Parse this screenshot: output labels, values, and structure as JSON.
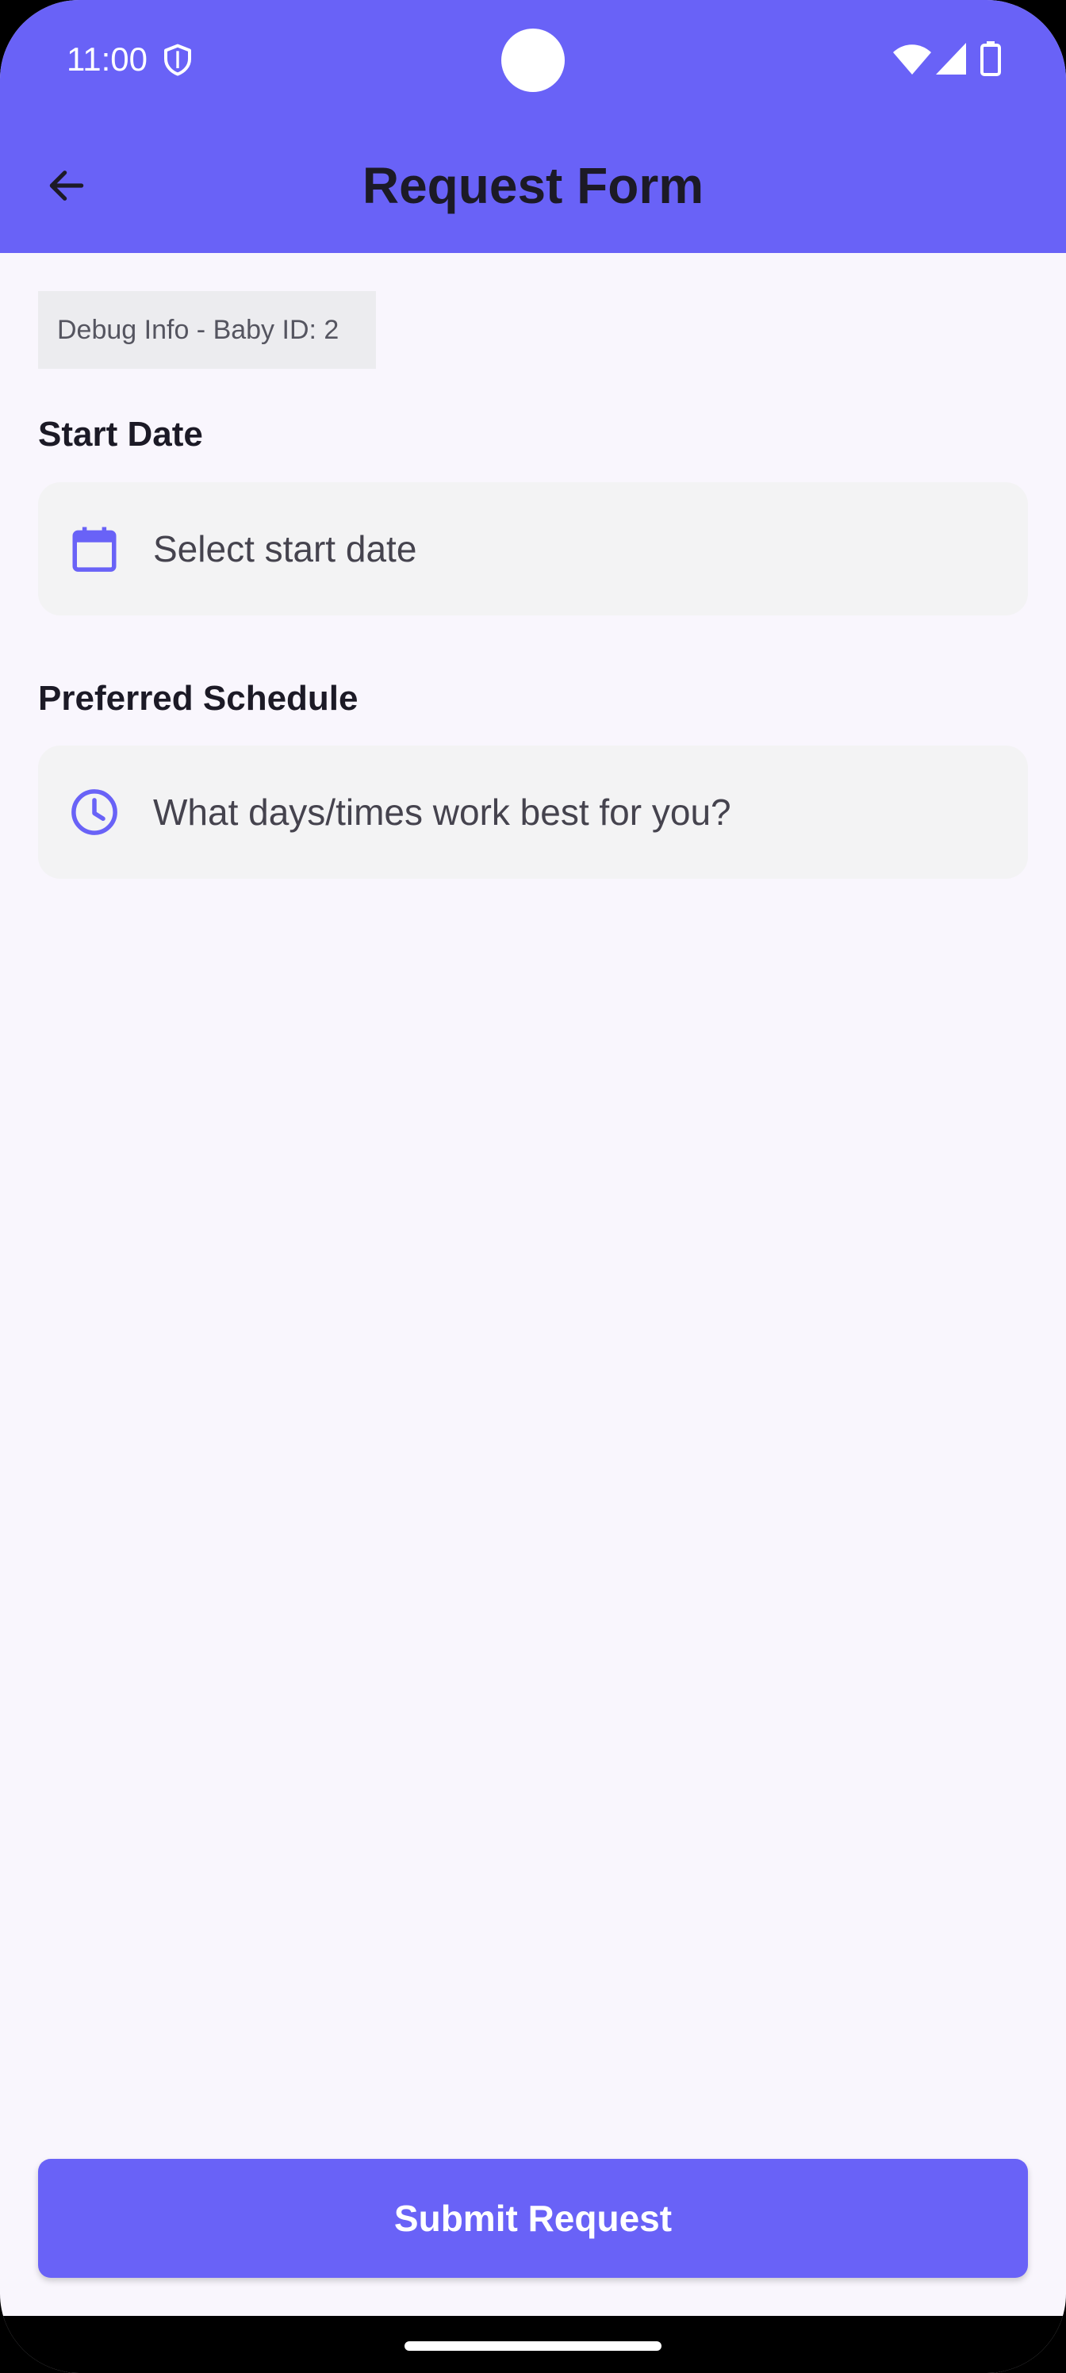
{
  "status_bar": {
    "time": "11:00",
    "icons": [
      "shield-icon",
      "wifi-icon",
      "signal-icon",
      "battery-icon"
    ]
  },
  "app_bar": {
    "title": "Request Form",
    "back_icon": "arrow-back-icon",
    "background": "#6962f7"
  },
  "debug": {
    "text": "Debug Info - Baby ID: 2"
  },
  "form": {
    "start_date": {
      "label": "Start Date",
      "placeholder": "Select start date",
      "icon": "calendar-icon"
    },
    "schedule": {
      "label": "Preferred Schedule",
      "placeholder": "What days/times work best for you?",
      "icon": "clock-icon"
    }
  },
  "actions": {
    "submit_label": "Submit Request"
  },
  "colors": {
    "accent": "#6962f7",
    "field_bg": "#f3f3f4",
    "page_bg": "#f9f6fd"
  }
}
